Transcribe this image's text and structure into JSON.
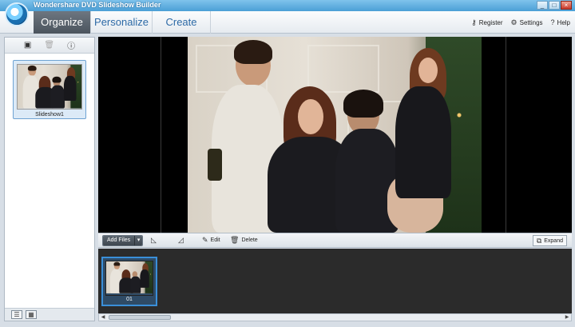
{
  "window": {
    "title": "Wondershare DVD Slideshow Builder",
    "buttons": [
      "_",
      "□",
      "×"
    ]
  },
  "nav": {
    "tabs": [
      {
        "label": "Organize",
        "active": true
      },
      {
        "label": "Personalize",
        "active": false
      },
      {
        "label": "Create",
        "active": false
      }
    ],
    "links": [
      {
        "label": "Register",
        "icon": "key-icon"
      },
      {
        "label": "Settings",
        "icon": "gear-icon"
      },
      {
        "label": "Help",
        "icon": "help-icon"
      }
    ]
  },
  "left_panel": {
    "toolbar_icons": [
      "add-slideshow-icon",
      "delete-icon",
      "info-icon"
    ],
    "slideshow": {
      "label": "Slideshow1"
    },
    "view_icons": [
      "list-view-icon",
      "thumbnail-view-icon"
    ]
  },
  "toolbar": {
    "add_files": "Add Files",
    "edit": "Edit",
    "delete": "Delete",
    "expand": "Expand"
  },
  "timeline": {
    "clips": [
      {
        "label": "01"
      }
    ]
  },
  "colors": {
    "accent": "#3a8fd9",
    "active_tab": "#4b545e",
    "timeline_bg": "#2b2b2b"
  }
}
